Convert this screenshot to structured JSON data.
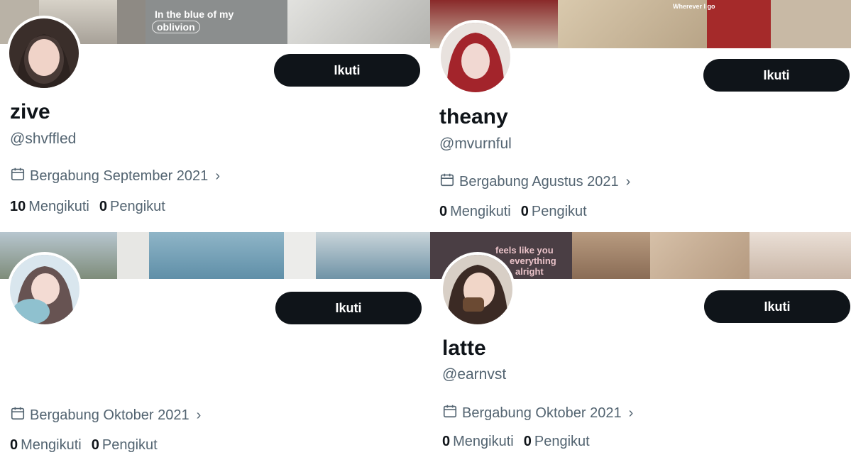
{
  "cards": [
    {
      "name": "zive",
      "handle": "@shvffled",
      "joined": "Bergabung September 2021",
      "following_count": "10",
      "following_label": "Mengikuti",
      "followers_count": "0",
      "followers_label": "Pengikut",
      "follow_label": "Ikuti",
      "banner_text_1": "In the blue of my",
      "banner_text_2": "oblivion"
    },
    {
      "name": "theany",
      "handle": "@mvurnful",
      "joined": "Bergabung Agustus 2021",
      "following_count": "0",
      "following_label": "Mengikuti",
      "followers_count": "0",
      "followers_label": "Pengikut",
      "follow_label": "Ikuti",
      "banner_text_1": "Wherever I go"
    },
    {
      "name": "",
      "handle": "",
      "joined": "Bergabung Oktober 2021",
      "following_count": "0",
      "following_label": "Mengikuti",
      "followers_count": "0",
      "followers_label": "Pengikut",
      "follow_label": "Ikuti"
    },
    {
      "name": "latte",
      "handle": "@earnvst",
      "joined": "Bergabung Oktober 2021",
      "following_count": "0",
      "following_label": "Mengikuti",
      "followers_count": "0",
      "followers_label": "Pengikut",
      "follow_label": "Ikuti",
      "banner_text_1": "feels like you",
      "banner_text_2": "everything",
      "banner_text_3": "alright"
    }
  ],
  "icons": {
    "calendar": "calendar-icon",
    "chevron": "chevron-right-icon"
  },
  "colors": {
    "button": "#0f1419",
    "secondary_text": "#536471",
    "primary_text": "#0f1419"
  }
}
